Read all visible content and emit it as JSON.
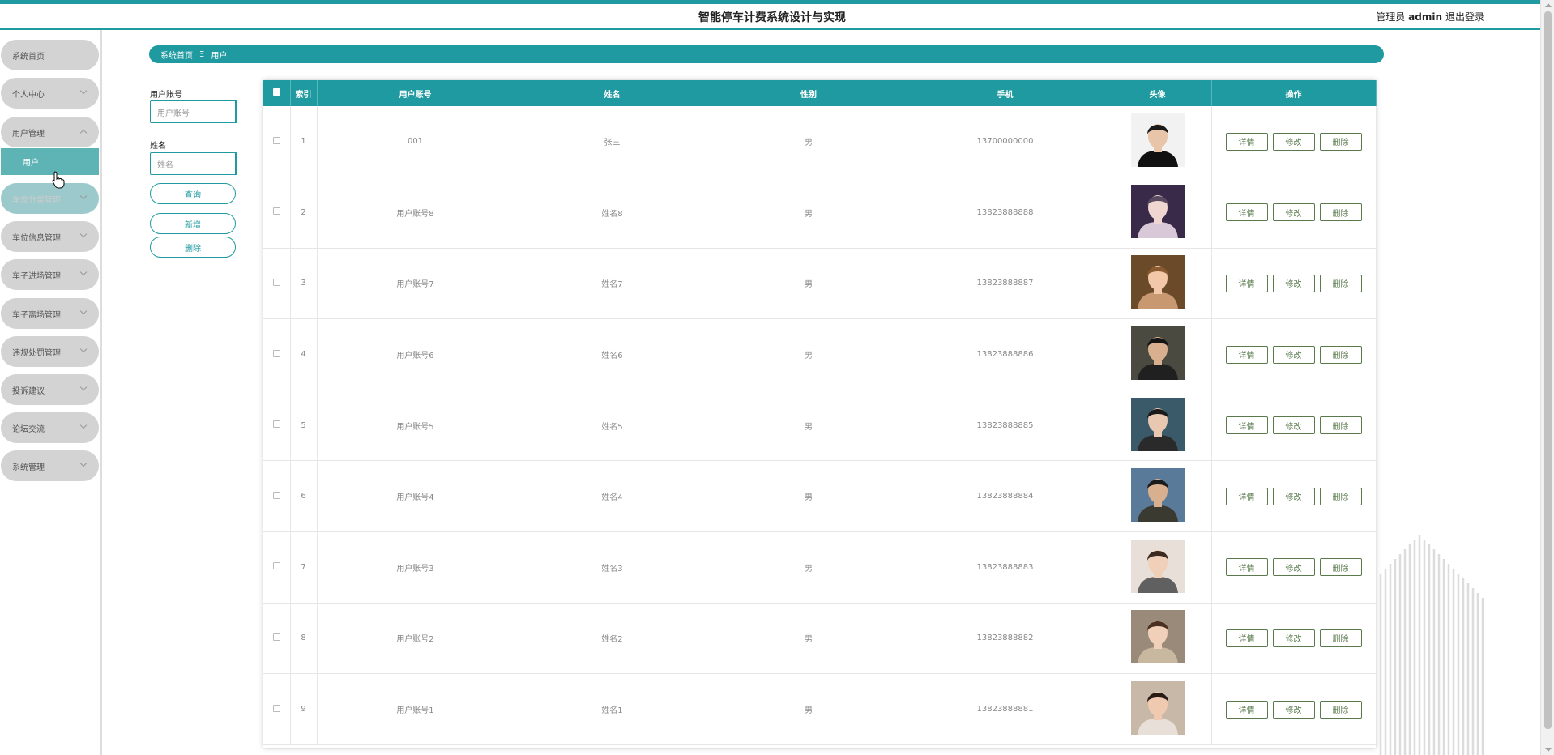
{
  "header": {
    "title": "智能停车计费系统设计与实现",
    "admin_prefix": "管理员",
    "admin_name": "admin",
    "logout": "退出登录"
  },
  "sidebar": {
    "items": [
      {
        "label": "系统首页",
        "chevron": "none"
      },
      {
        "label": "个人中心",
        "chevron": "down"
      },
      {
        "label": "用户管理",
        "chevron": "up"
      },
      {
        "label": "车位分类管理",
        "chevron": "down"
      },
      {
        "label": "车位信息管理",
        "chevron": "down"
      },
      {
        "label": "车子进场管理",
        "chevron": "down"
      },
      {
        "label": "车子离场管理",
        "chevron": "down"
      },
      {
        "label": "违规处罚管理",
        "chevron": "down"
      },
      {
        "label": "投诉建议",
        "chevron": "down"
      },
      {
        "label": "论坛交流",
        "chevron": "down"
      },
      {
        "label": "系统管理",
        "chevron": "down"
      }
    ],
    "submenu_label": "用户"
  },
  "breadcrumb": {
    "home": "系统首页",
    "separator": "Ξ",
    "current": "用户"
  },
  "search": {
    "account_label": "用户账号",
    "account_placeholder": "用户账号",
    "name_label": "姓名",
    "name_placeholder": "姓名",
    "query_btn": "查询",
    "add_btn": "新增",
    "delete_btn": "删除"
  },
  "table": {
    "headers": [
      "",
      "索引",
      "用户账号",
      "姓名",
      "性别",
      "手机",
      "头像",
      "操作"
    ],
    "rows": [
      {
        "index": "1",
        "account": "001",
        "name": "张三",
        "gender": "男",
        "phone": "13700000000"
      },
      {
        "index": "2",
        "account": "用户账号8",
        "name": "姓名8",
        "gender": "男",
        "phone": "13823888888"
      },
      {
        "index": "3",
        "account": "用户账号7",
        "name": "姓名7",
        "gender": "男",
        "phone": "13823888887"
      },
      {
        "index": "4",
        "account": "用户账号6",
        "name": "姓名6",
        "gender": "男",
        "phone": "13823888886"
      },
      {
        "index": "5",
        "account": "用户账号5",
        "name": "姓名5",
        "gender": "男",
        "phone": "13823888885"
      },
      {
        "index": "6",
        "account": "用户账号4",
        "name": "姓名4",
        "gender": "男",
        "phone": "13823888884"
      },
      {
        "index": "7",
        "account": "用户账号3",
        "name": "姓名3",
        "gender": "男",
        "phone": "13823888883"
      },
      {
        "index": "8",
        "account": "用户账号2",
        "name": "姓名2",
        "gender": "男",
        "phone": "13823888882"
      },
      {
        "index": "9",
        "account": "用户账号1",
        "name": "姓名1",
        "gender": "男",
        "phone": "13823888881"
      }
    ],
    "ops": {
      "detail": "详情",
      "edit": "修改",
      "delete": "删除"
    }
  },
  "colors": {
    "accent": "#1f9aa0",
    "sidebar_item": "#d3d3d3",
    "sidebar_submenu": "#5eb3b5",
    "op_button": "#5a7a4e"
  }
}
